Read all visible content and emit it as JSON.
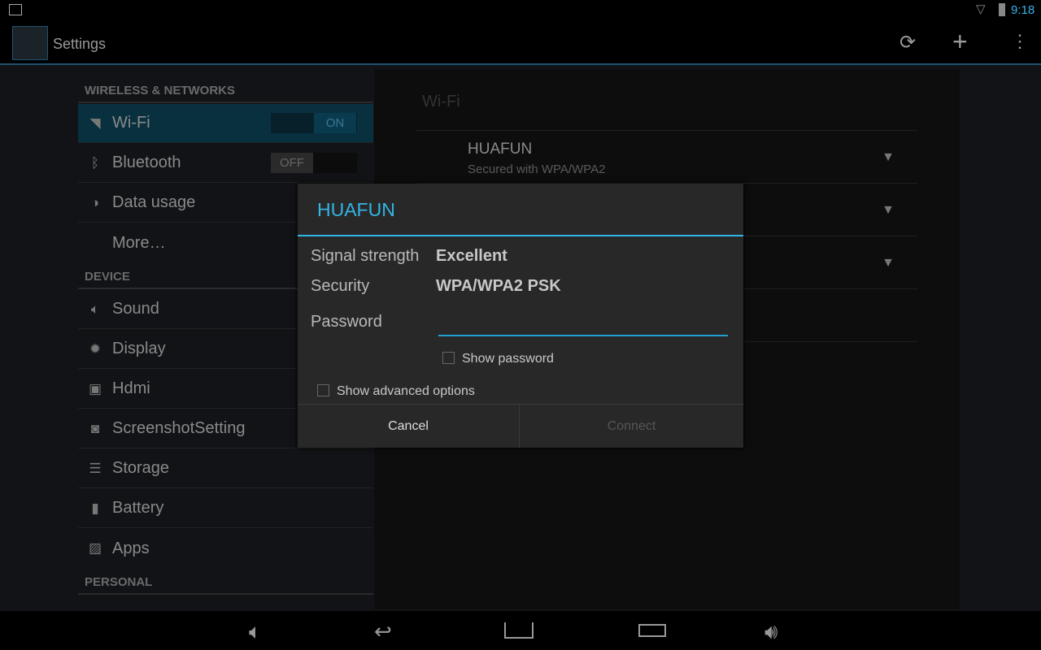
{
  "status": {
    "time": "9:18",
    "icons": [
      "image-icon",
      "wifi-icon",
      "battery-icon"
    ]
  },
  "actionbar": {
    "title": "Settings",
    "actions": [
      "sync-icon",
      "add-icon",
      "overflow-menu-icon"
    ]
  },
  "sidebar": {
    "sections": [
      {
        "header": "WIRELESS & NETWORKS",
        "items": [
          {
            "label": "Wi-Fi",
            "icon": "wifi-icon",
            "toggle": "ON",
            "selected": true
          },
          {
            "label": "Bluetooth",
            "icon": "bluetooth-icon",
            "toggle": "OFF"
          },
          {
            "label": "Data usage",
            "icon": "data-usage-icon"
          },
          {
            "label": "More…",
            "icon": ""
          }
        ]
      },
      {
        "header": "DEVICE",
        "items": [
          {
            "label": "Sound",
            "icon": "sound-icon"
          },
          {
            "label": "Display",
            "icon": "display-icon"
          },
          {
            "label": "Hdmi",
            "icon": "hdmi-icon"
          },
          {
            "label": "ScreenshotSetting",
            "icon": "camera-icon"
          },
          {
            "label": "Storage",
            "icon": "storage-icon"
          },
          {
            "label": "Battery",
            "icon": "battery-icon"
          },
          {
            "label": "Apps",
            "icon": "apps-icon"
          }
        ]
      },
      {
        "header": "PERSONAL",
        "items": []
      }
    ]
  },
  "pane": {
    "title": "Wi-Fi",
    "networks": [
      {
        "ssid": "HUAFUN",
        "summary": "Secured with WPA/WPA2"
      },
      {
        "ssid": "",
        "summary": ""
      },
      {
        "ssid": "",
        "summary": ""
      }
    ]
  },
  "dialog": {
    "title": "HUAFUN",
    "signal_label": "Signal strength",
    "signal_value": "Excellent",
    "security_label": "Security",
    "security_value": "WPA/WPA2 PSK",
    "password_label": "Password",
    "password_value": "",
    "show_password": "Show password",
    "show_advanced": "Show advanced options",
    "cancel": "Cancel",
    "connect": "Connect"
  },
  "colors": {
    "accent": "#33b5e5",
    "selected_row": "#09303f"
  }
}
